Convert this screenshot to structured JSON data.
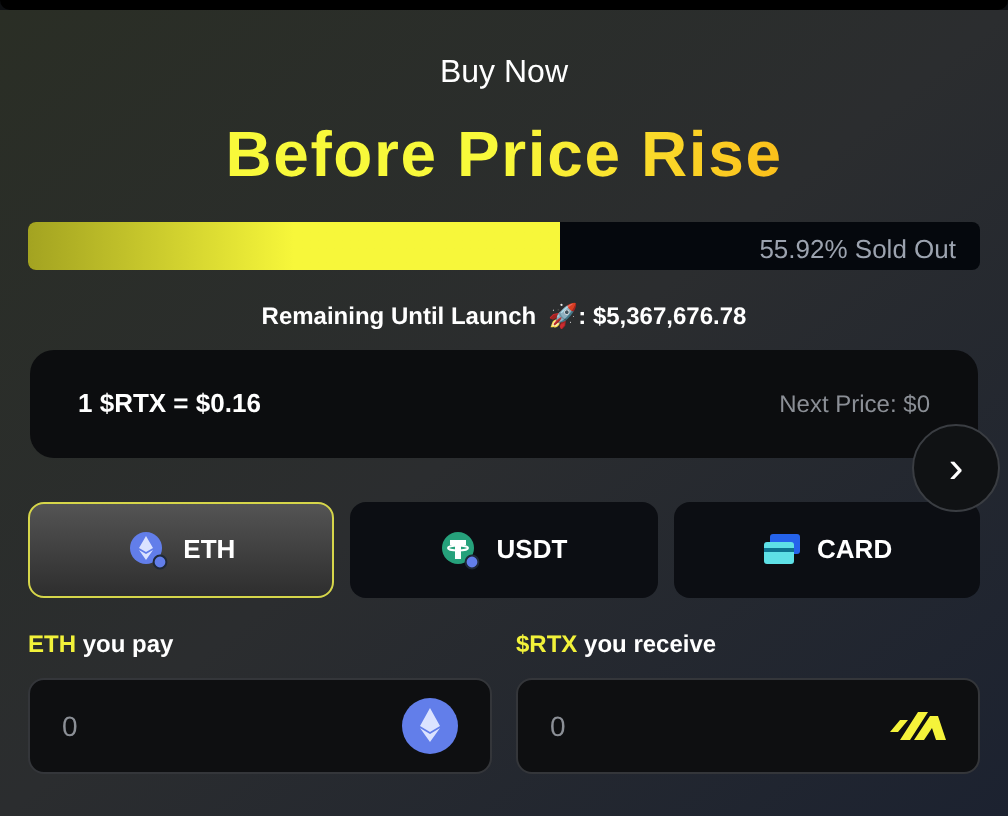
{
  "subtitle": "Buy Now",
  "title": "Before Price Rise",
  "progress": {
    "level": 0.5592,
    "label": "55.92% Sold Out"
  },
  "remaining": {
    "label": "Remaining Until Launch",
    "icon": "🚀",
    "value": ": $5,367,676.78"
  },
  "price": {
    "current": "1 $RTX = $0.16",
    "next": "Next Price: $0"
  },
  "next_button": {
    "icon": "›"
  },
  "tabs": [
    {
      "label": "ETH",
      "kind": "eth",
      "selected": true
    },
    {
      "label": "USDT",
      "kind": "usdt",
      "selected": false
    },
    {
      "label": "CARD",
      "kind": "card",
      "selected": false
    }
  ],
  "fields": [
    {
      "token": "ETH",
      "label": "you pay",
      "value": "0",
      "kind": "eth"
    },
    {
      "token": "$RTX",
      "label": "you receive",
      "value": "0",
      "kind": "rtx"
    }
  ]
}
